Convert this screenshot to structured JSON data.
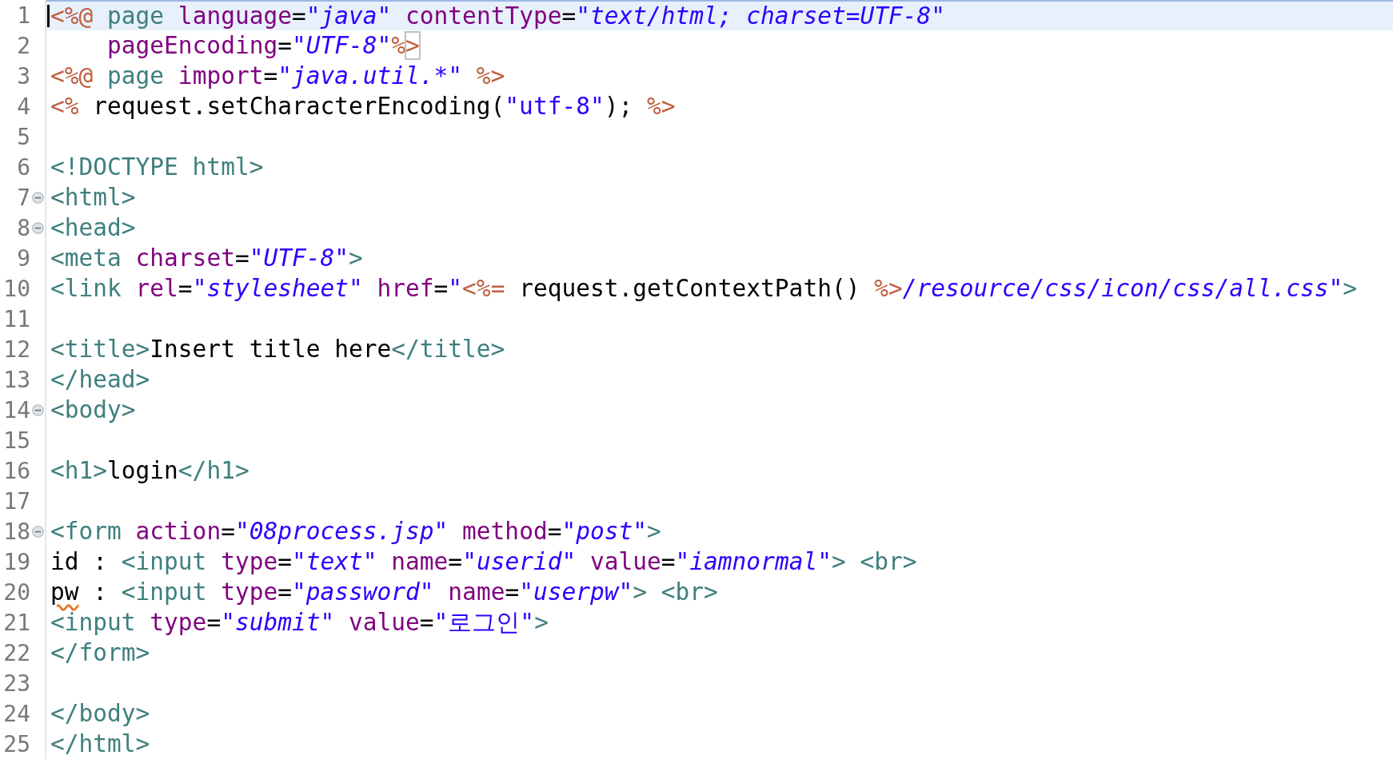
{
  "editor": {
    "lines": [
      {
        "number": "1",
        "current": true,
        "foldable": false,
        "tokens": [
          {
            "kind": "jsp",
            "text": "<%@"
          },
          {
            "kind": "tag",
            "text": " page"
          },
          {
            "kind": "attr",
            "text": " language"
          },
          {
            "kind": "plain",
            "text": "="
          },
          {
            "kind": "value",
            "text": "\"java\""
          },
          {
            "kind": "attr",
            "text": " contentType"
          },
          {
            "kind": "plain",
            "text": "="
          },
          {
            "kind": "value",
            "text": "\"text/html; charset=UTF-8\""
          }
        ]
      },
      {
        "number": "2",
        "current": false,
        "foldable": false,
        "tokens": [
          {
            "kind": "attr",
            "text": "    pageEncoding"
          },
          {
            "kind": "plain",
            "text": "="
          },
          {
            "kind": "value",
            "text": "\"UTF-8\""
          },
          {
            "kind": "jsp",
            "text": "%"
          },
          {
            "kind": "jsp",
            "text": ">",
            "matched": true
          }
        ]
      },
      {
        "number": "3",
        "current": false,
        "foldable": false,
        "tokens": [
          {
            "kind": "jsp",
            "text": "<%@"
          },
          {
            "kind": "tag",
            "text": " page"
          },
          {
            "kind": "attr",
            "text": " import"
          },
          {
            "kind": "plain",
            "text": "="
          },
          {
            "kind": "value",
            "text": "\"java.util.*\""
          },
          {
            "kind": "jsp",
            "text": " %>"
          }
        ]
      },
      {
        "number": "4",
        "current": false,
        "foldable": false,
        "tokens": [
          {
            "kind": "jsp",
            "text": "<%"
          },
          {
            "kind": "plain",
            "text": " request.setCharacterEncoding("
          },
          {
            "kind": "string",
            "text": "\"utf-8\""
          },
          {
            "kind": "plain",
            "text": "); "
          },
          {
            "kind": "jsp",
            "text": "%>"
          }
        ]
      },
      {
        "number": "5",
        "current": false,
        "foldable": false
      },
      {
        "number": "6",
        "current": false,
        "foldable": false,
        "tokens": [
          {
            "kind": "tag",
            "text": "<!DOCTYPE html>"
          }
        ]
      },
      {
        "number": "7",
        "current": false,
        "foldable": true,
        "tokens": [
          {
            "kind": "tag",
            "text": "<html>"
          }
        ]
      },
      {
        "number": "8",
        "current": false,
        "foldable": true,
        "tokens": [
          {
            "kind": "tag",
            "text": "<head>"
          }
        ]
      },
      {
        "number": "9",
        "current": false,
        "foldable": false,
        "tokens": [
          {
            "kind": "tag",
            "text": "<meta"
          },
          {
            "kind": "attr",
            "text": " charset"
          },
          {
            "kind": "plain",
            "text": "="
          },
          {
            "kind": "value",
            "text": "\"UTF-8\""
          },
          {
            "kind": "tag",
            "text": ">"
          }
        ]
      },
      {
        "number": "10",
        "current": false,
        "foldable": false,
        "tokens": [
          {
            "kind": "tag",
            "text": "<link"
          },
          {
            "kind": "attr",
            "text": " rel"
          },
          {
            "kind": "plain",
            "text": "="
          },
          {
            "kind": "value",
            "text": "\"stylesheet\""
          },
          {
            "kind": "attr",
            "text": " href"
          },
          {
            "kind": "plain",
            "text": "="
          },
          {
            "kind": "string",
            "text": "\""
          },
          {
            "kind": "jsp",
            "text": "<%="
          },
          {
            "kind": "plain",
            "text": " request.getContextPath() "
          },
          {
            "kind": "jsp",
            "text": "%>"
          },
          {
            "kind": "value",
            "text": "/resource/css/icon/css/all.css"
          },
          {
            "kind": "string",
            "text": "\""
          },
          {
            "kind": "tag",
            "text": ">"
          }
        ]
      },
      {
        "number": "11",
        "current": false,
        "foldable": false
      },
      {
        "number": "12",
        "current": false,
        "foldable": false,
        "tokens": [
          {
            "kind": "tag",
            "text": "<title>"
          },
          {
            "kind": "plain",
            "text": "Insert title here"
          },
          {
            "kind": "tag",
            "text": "</title>"
          }
        ]
      },
      {
        "number": "13",
        "current": false,
        "foldable": false,
        "tokens": [
          {
            "kind": "tag",
            "text": "</head>"
          }
        ]
      },
      {
        "number": "14",
        "current": false,
        "foldable": true,
        "tokens": [
          {
            "kind": "tag",
            "text": "<body>"
          }
        ]
      },
      {
        "number": "15",
        "current": false,
        "foldable": false
      },
      {
        "number": "16",
        "current": false,
        "foldable": false,
        "tokens": [
          {
            "kind": "tag",
            "text": "<h1>"
          },
          {
            "kind": "plain",
            "text": "login"
          },
          {
            "kind": "tag",
            "text": "</h1>"
          }
        ]
      },
      {
        "number": "17",
        "current": false,
        "foldable": false
      },
      {
        "number": "18",
        "current": false,
        "foldable": true,
        "tokens": [
          {
            "kind": "tag",
            "text": "<form"
          },
          {
            "kind": "attr",
            "text": " action"
          },
          {
            "kind": "plain",
            "text": "="
          },
          {
            "kind": "value",
            "text": "\"08process.jsp\""
          },
          {
            "kind": "attr",
            "text": " method"
          },
          {
            "kind": "plain",
            "text": "="
          },
          {
            "kind": "value",
            "text": "\"post\""
          },
          {
            "kind": "tag",
            "text": ">"
          }
        ]
      },
      {
        "number": "19",
        "current": false,
        "foldable": false,
        "tokens": [
          {
            "kind": "plain",
            "text": "id : "
          },
          {
            "kind": "tag",
            "text": "<input"
          },
          {
            "kind": "attr",
            "text": " type"
          },
          {
            "kind": "plain",
            "text": "="
          },
          {
            "kind": "value",
            "text": "\"text\""
          },
          {
            "kind": "attr",
            "text": " name"
          },
          {
            "kind": "plain",
            "text": "="
          },
          {
            "kind": "value",
            "text": "\"userid\""
          },
          {
            "kind": "attr",
            "text": " value"
          },
          {
            "kind": "plain",
            "text": "="
          },
          {
            "kind": "value",
            "text": "\"iamnormal\""
          },
          {
            "kind": "tag",
            "text": "> <br>"
          }
        ]
      },
      {
        "number": "20",
        "current": false,
        "foldable": false,
        "tokens": [
          {
            "kind": "plain",
            "text": "pw",
            "misspelled": true
          },
          {
            "kind": "plain",
            "text": " : "
          },
          {
            "kind": "tag",
            "text": "<input"
          },
          {
            "kind": "attr",
            "text": " type"
          },
          {
            "kind": "plain",
            "text": "="
          },
          {
            "kind": "value",
            "text": "\"password\""
          },
          {
            "kind": "attr",
            "text": " name"
          },
          {
            "kind": "plain",
            "text": "="
          },
          {
            "kind": "value",
            "text": "\"userpw\""
          },
          {
            "kind": "tag",
            "text": "> <br>"
          }
        ]
      },
      {
        "number": "21",
        "current": false,
        "foldable": false,
        "tokens": [
          {
            "kind": "tag",
            "text": "<input"
          },
          {
            "kind": "attr",
            "text": " type"
          },
          {
            "kind": "plain",
            "text": "="
          },
          {
            "kind": "value",
            "text": "\"submit\""
          },
          {
            "kind": "attr",
            "text": " value"
          },
          {
            "kind": "plain",
            "text": "="
          },
          {
            "kind": "string",
            "text": "\"로그인\""
          },
          {
            "kind": "tag",
            "text": ">"
          }
        ]
      },
      {
        "number": "22",
        "current": false,
        "foldable": false,
        "tokens": [
          {
            "kind": "tag",
            "text": "</form>"
          }
        ]
      },
      {
        "number": "23",
        "current": false,
        "foldable": false
      },
      {
        "number": "24",
        "current": false,
        "foldable": false,
        "tokens": [
          {
            "kind": "tag",
            "text": "</body>"
          }
        ]
      },
      {
        "number": "25",
        "current": false,
        "foldable": false,
        "tokens": [
          {
            "kind": "tag",
            "text": "</html>"
          }
        ]
      }
    ]
  }
}
